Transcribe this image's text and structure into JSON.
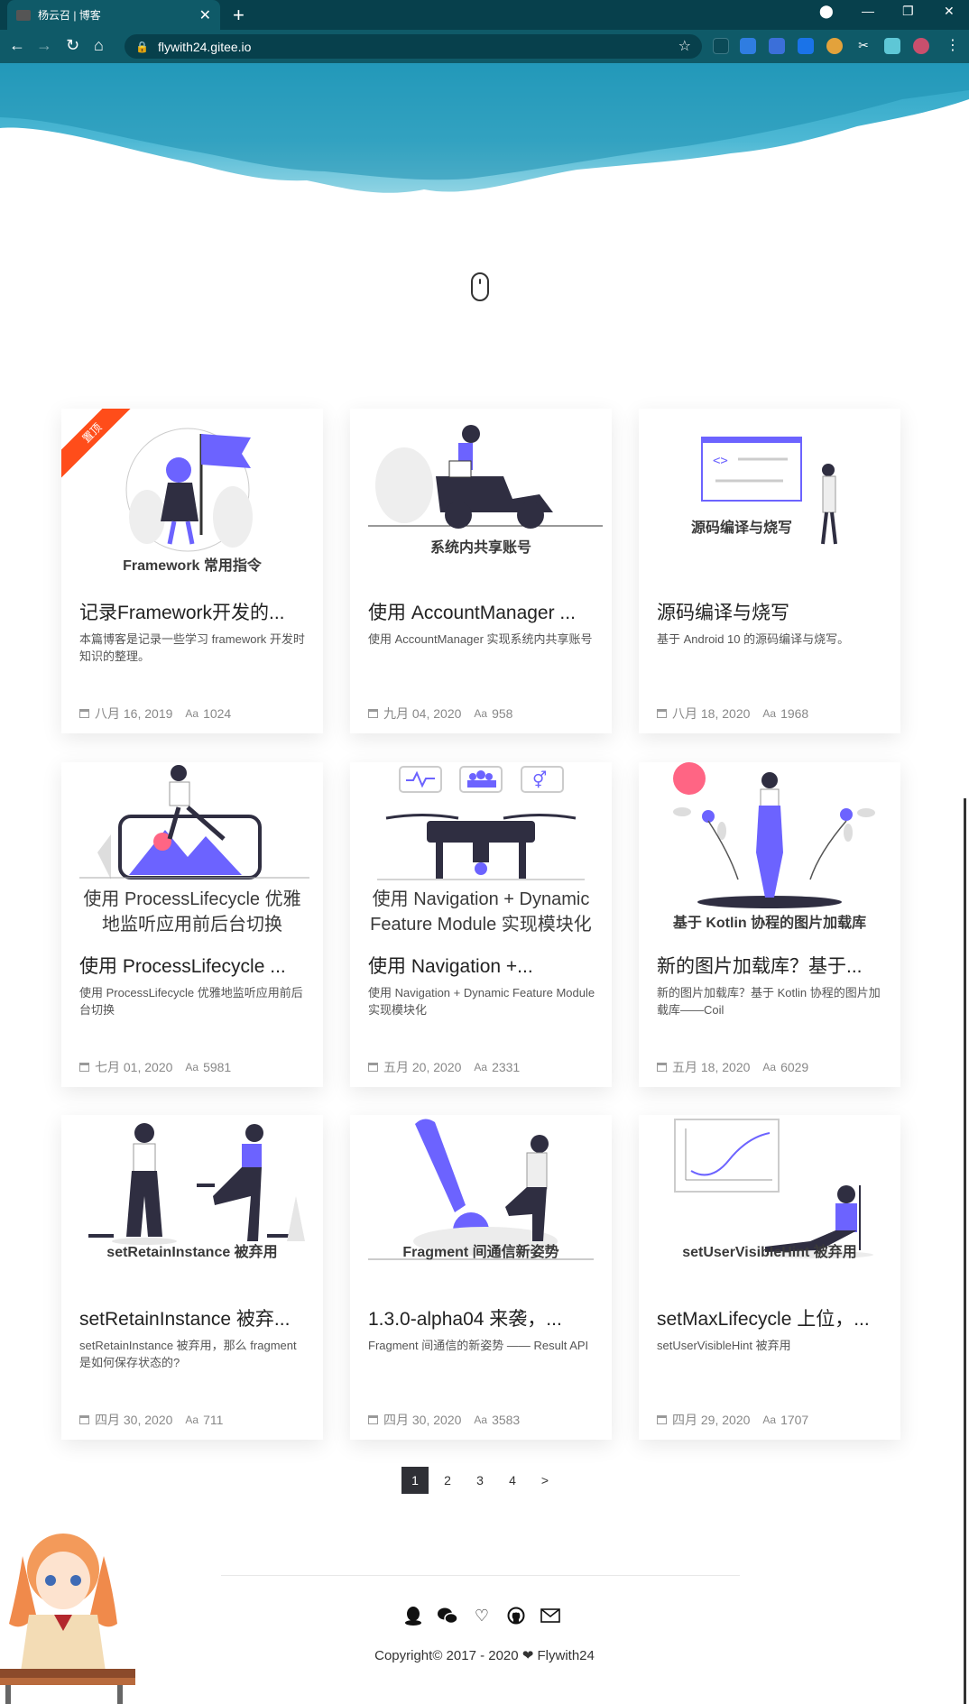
{
  "browser": {
    "tab_title": "杨云召 | 博客",
    "url": "flywith24.gitee.io"
  },
  "posts": [
    {
      "title": "记录Framework开发的...",
      "desc": "本篇博客是记录一些学习 framework 开发时知识的整理。",
      "date": "八月 16, 2019",
      "words": "1024",
      "pinned_label": "置顶",
      "image_text": "Framework 常用指令"
    },
    {
      "title": "使用 AccountManager ...",
      "desc": "使用 AccountManager 实现系统内共享账号",
      "date": "九月 04, 2020",
      "words": "958",
      "image_text": "系统内共享账号"
    },
    {
      "title": "源码编译与烧写",
      "desc": "基于 Android 10 的源码编译与烧写。",
      "date": "八月 18, 2020",
      "words": "1968",
      "image_text": "源码编译与烧写"
    },
    {
      "title": "使用 ProcessLifecycle ...",
      "desc": "使用 ProcessLifecycle 优雅地监听应用前后台切换",
      "date": "七月 01, 2020",
      "words": "5981",
      "image_text_1": "使用 ProcessLifecycle 优雅",
      "image_text_2": "地监听应用前后台切换"
    },
    {
      "title": "使用 Navigation +...",
      "desc": "使用 Navigation + Dynamic Feature Module 实现模块化",
      "date": "五月 20, 2020",
      "words": "2331",
      "image_text_1": "使用 Navigation + Dynamic",
      "image_text_2": "Feature Module 实现模块化"
    },
    {
      "title": "新的图片加载库？基于...",
      "desc": "新的图片加载库？基于 Kotlin 协程的图片加载库——Coil",
      "date": "五月 18, 2020",
      "words": "6029",
      "image_text": "基于 Kotlin 协程的图片加载库"
    },
    {
      "title": "setRetainInstance 被弃...",
      "desc": "setRetainInstance 被弃用，那么 fragment 是如何保存状态的?",
      "date": "四月 30, 2020",
      "words": "711",
      "image_text": "setRetainInstance 被弃用"
    },
    {
      "title": "1.3.0-alpha04 来袭，...",
      "desc": "Fragment 间通信的新姿势 —— Result API",
      "date": "四月 30, 2020",
      "words": "3583",
      "image_text": "Fragment 间通信新姿势"
    },
    {
      "title": "setMaxLifecycle 上位，...",
      "desc": "setUserVisibleHint 被弃用",
      "date": "四月 29, 2020",
      "words": "1707",
      "image_text": "setUserVisibleHint 被弃用"
    }
  ],
  "pagination": {
    "p1": "1",
    "p2": "2",
    "p3": "3",
    "p4": "4",
    "next": ">"
  },
  "footer": {
    "copyright": "Copyright© 2017 - 2020 ❤ Flywith24"
  },
  "colors": {
    "accent": "#6c63ff",
    "ribbon": "#ff4d1a",
    "hero": "#2aa3c4"
  }
}
